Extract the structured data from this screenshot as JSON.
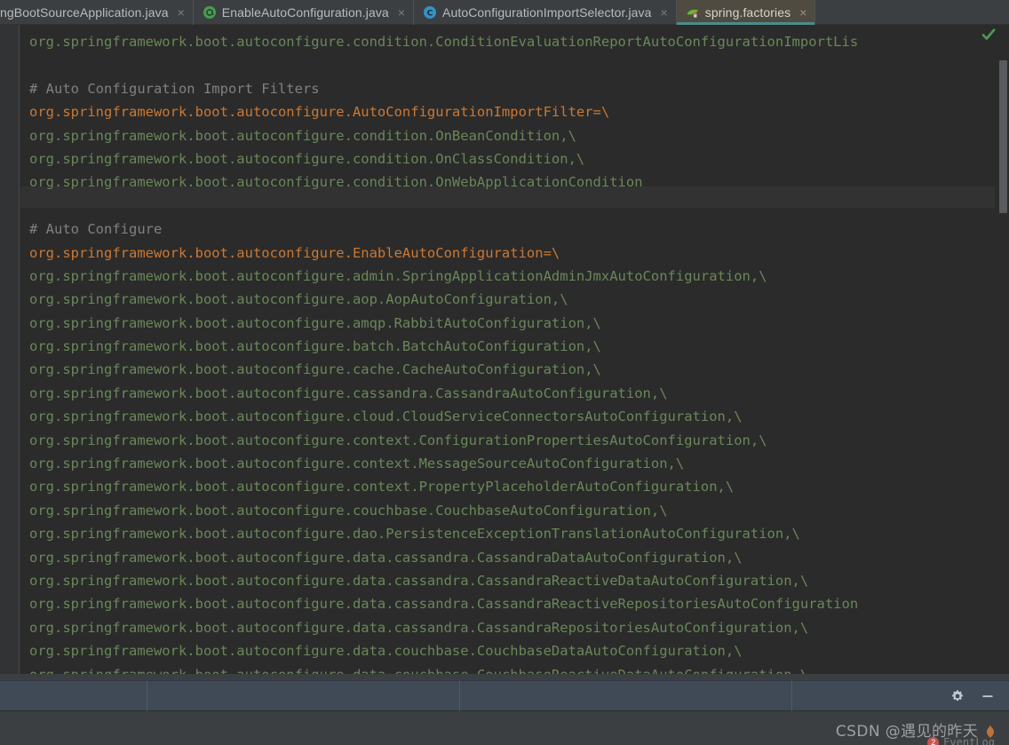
{
  "window": {
    "theme_bg": "#3C3F41",
    "editor_bg": "#2B2B2B",
    "accent_teal": "#4C8B8B",
    "status_bar_bg": "#3F4A56"
  },
  "tabs": [
    {
      "label": "ngBootSourceApplication.java",
      "icon": "none",
      "active": false,
      "close": "×",
      "truncated_left": true
    },
    {
      "label": "EnableAutoConfiguration.java",
      "icon": "annotation-icon",
      "icon_color": "#499C54",
      "active": false,
      "close": "×"
    },
    {
      "label": "AutoConfigurationImportSelector.java",
      "icon": "java-class-icon",
      "icon_color": "#3592C4",
      "active": false,
      "close": "×"
    },
    {
      "label": "spring.factories",
      "icon": "spring-leaf-icon",
      "icon_color": "#6DB33F",
      "active": true,
      "close": "×"
    }
  ],
  "editor": {
    "file": "spring.factories",
    "syntax_colors": {
      "comment": "#808080",
      "key": "#CC7832",
      "value": "#6A8759"
    },
    "inspection_status": "ok-check",
    "lines": [
      {
        "type": "value",
        "text": "org.springframework.boot.autoconfigure.condition.ConditionEvaluationReportAutoConfigurationImportLis"
      },
      {
        "type": "blank",
        "text": ""
      },
      {
        "type": "comment",
        "text": "# Auto Configuration Import Filters"
      },
      {
        "type": "key",
        "text": "org.springframework.boot.autoconfigure.AutoConfigurationImportFilter=\\"
      },
      {
        "type": "value",
        "text": "org.springframework.boot.autoconfigure.condition.OnBeanCondition,\\"
      },
      {
        "type": "value",
        "text": "org.springframework.boot.autoconfigure.condition.OnClassCondition,\\"
      },
      {
        "type": "value",
        "text": "org.springframework.boot.autoconfigure.condition.OnWebApplicationCondition"
      },
      {
        "type": "blank",
        "text": ""
      },
      {
        "type": "comment",
        "text": "# Auto Configure"
      },
      {
        "type": "key",
        "text": "org.springframework.boot.autoconfigure.EnableAutoConfiguration=\\"
      },
      {
        "type": "value",
        "text": "org.springframework.boot.autoconfigure.admin.SpringApplicationAdminJmxAutoConfiguration,\\"
      },
      {
        "type": "value",
        "text": "org.springframework.boot.autoconfigure.aop.AopAutoConfiguration,\\"
      },
      {
        "type": "value",
        "text": "org.springframework.boot.autoconfigure.amqp.RabbitAutoConfiguration,\\"
      },
      {
        "type": "value",
        "text": "org.springframework.boot.autoconfigure.batch.BatchAutoConfiguration,\\"
      },
      {
        "type": "value",
        "text": "org.springframework.boot.autoconfigure.cache.CacheAutoConfiguration,\\"
      },
      {
        "type": "value",
        "text": "org.springframework.boot.autoconfigure.cassandra.CassandraAutoConfiguration,\\"
      },
      {
        "type": "value",
        "text": "org.springframework.boot.autoconfigure.cloud.CloudServiceConnectorsAutoConfiguration,\\"
      },
      {
        "type": "value",
        "text": "org.springframework.boot.autoconfigure.context.ConfigurationPropertiesAutoConfiguration,\\"
      },
      {
        "type": "value",
        "text": "org.springframework.boot.autoconfigure.context.MessageSourceAutoConfiguration,\\"
      },
      {
        "type": "value",
        "text": "org.springframework.boot.autoconfigure.context.PropertyPlaceholderAutoConfiguration,\\"
      },
      {
        "type": "value",
        "text": "org.springframework.boot.autoconfigure.couchbase.CouchbaseAutoConfiguration,\\"
      },
      {
        "type": "value",
        "text": "org.springframework.boot.autoconfigure.dao.PersistenceExceptionTranslationAutoConfiguration,\\"
      },
      {
        "type": "value",
        "text": "org.springframework.boot.autoconfigure.data.cassandra.CassandraDataAutoConfiguration,\\"
      },
      {
        "type": "value",
        "text": "org.springframework.boot.autoconfigure.data.cassandra.CassandraReactiveDataAutoConfiguration,\\"
      },
      {
        "type": "value",
        "text": "org.springframework.boot.autoconfigure.data.cassandra.CassandraReactiveRepositoriesAutoConfiguration"
      },
      {
        "type": "value",
        "text": "org.springframework.boot.autoconfigure.data.cassandra.CassandraRepositoriesAutoConfiguration,\\"
      },
      {
        "type": "value",
        "text": "org.springframework.boot.autoconfigure.data.couchbase.CouchbaseDataAutoConfiguration,\\"
      },
      {
        "type": "value",
        "text": "org.springframework.boot.autoconfigure.data.couchbase.CouchbaseReactiveDataAutoConfiguration,\\"
      }
    ]
  },
  "scrollbars": {
    "vertical_label": "vertical-scrollbar",
    "horizontal_label": "horizontal-scrollbar"
  },
  "status_bar": {
    "segment_1": "",
    "segment_2": "",
    "segment_3": "",
    "gear_icon": "gear-icon",
    "minimize_icon": "minimize-icon"
  },
  "watermark": {
    "text": "CSDN @遇见的昨天"
  },
  "event_log": {
    "label": "EventLog",
    "badge": "2"
  }
}
